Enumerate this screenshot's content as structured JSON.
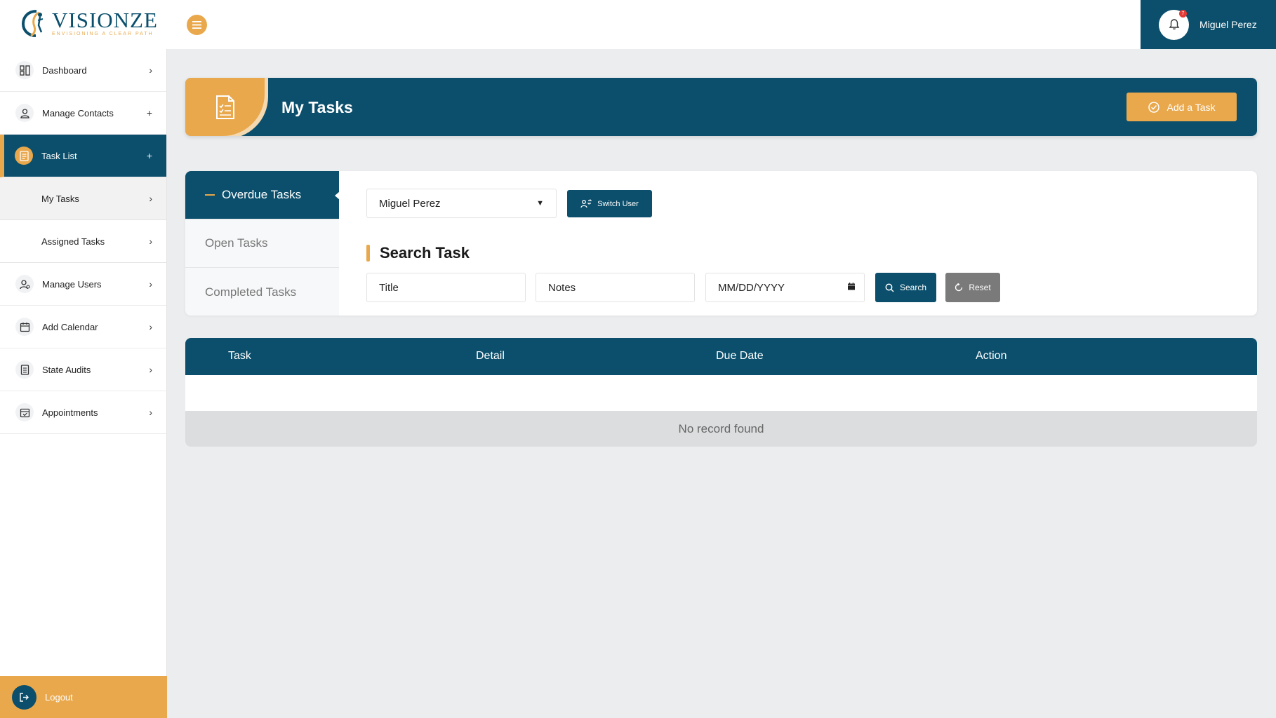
{
  "brand": {
    "name": "VISIONZE",
    "tagline": "ENVISIONING A CLEAR PATH",
    "accent_color": "#e9a84c",
    "primary_color": "#0b4f6c"
  },
  "header": {
    "menu_icon": "hamburger-icon",
    "notification_icon": "bell-icon",
    "notification_count": "7",
    "user_name": "Miguel Perez"
  },
  "sidebar": {
    "items": [
      {
        "label": "Dashboard",
        "icon": "dashboard-icon",
        "indicator": "›"
      },
      {
        "label": "Manage Contacts",
        "icon": "contacts-icon",
        "indicator": "+"
      },
      {
        "label": "Task List",
        "icon": "task-list-icon",
        "indicator": "+",
        "active": true
      },
      {
        "label": "Manage Users",
        "icon": "users-icon",
        "indicator": "›"
      },
      {
        "label": "Add Calendar",
        "icon": "calendar-icon",
        "indicator": "›"
      },
      {
        "label": "State Audits",
        "icon": "audit-icon",
        "indicator": "›"
      },
      {
        "label": "Appointments",
        "icon": "appointments-icon",
        "indicator": "›"
      }
    ],
    "sub_items": [
      {
        "label": "My Tasks",
        "indicator": "›"
      },
      {
        "label": "Assigned Tasks",
        "indicator": "›"
      }
    ],
    "logout_label": "Logout"
  },
  "page": {
    "title": "My Tasks",
    "add_task_label": "Add a Task"
  },
  "tabs": [
    {
      "label": "Overdue Tasks",
      "active": true
    },
    {
      "label": "Open Tasks"
    },
    {
      "label": "Completed Tasks"
    }
  ],
  "user_select": {
    "value": "Miguel Perez",
    "switch_label": "Switch User"
  },
  "search": {
    "heading": "Search Task",
    "title_placeholder": "Title",
    "notes_placeholder": "Notes",
    "date_placeholder": "MM/DD/YYYY",
    "search_label": "Search",
    "reset_label": "Reset"
  },
  "table": {
    "columns": [
      "Task",
      "Detail",
      "Due Date",
      "Action"
    ],
    "empty_message": "No record found"
  }
}
